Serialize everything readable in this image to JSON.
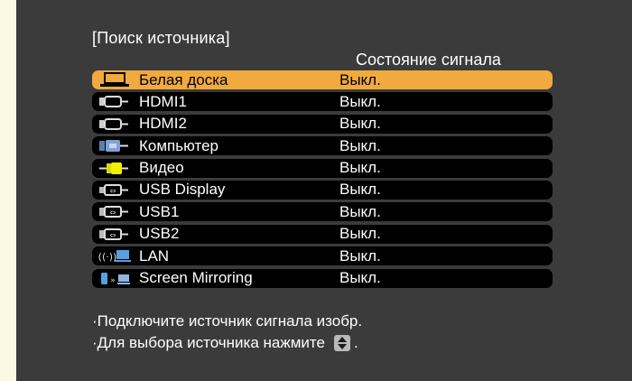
{
  "title": "[Поиск источника]",
  "status_header": "Состояние сигнала",
  "sources": [
    {
      "label": "Белая доска",
      "status": "Выкл.",
      "icon": "whiteboard-icon",
      "selected": true
    },
    {
      "label": "HDMI1",
      "status": "Выкл.",
      "icon": "hdmi-icon",
      "selected": false
    },
    {
      "label": "HDMI2",
      "status": "Выкл.",
      "icon": "hdmi-icon",
      "selected": false
    },
    {
      "label": "Компьютер",
      "status": "Выкл.",
      "icon": "computer-icon",
      "selected": false
    },
    {
      "label": "Видео",
      "status": "Выкл.",
      "icon": "video-icon",
      "selected": false
    },
    {
      "label": "USB Display",
      "status": "Выкл.",
      "icon": "usb-display-icon",
      "selected": false
    },
    {
      "label": "USB1",
      "status": "Выкл.",
      "icon": "usb-icon",
      "selected": false
    },
    {
      "label": "USB2",
      "status": "Выкл.",
      "icon": "usb-icon",
      "selected": false
    },
    {
      "label": "LAN",
      "status": "Выкл.",
      "icon": "lan-icon",
      "selected": false
    },
    {
      "label": "Screen Mirroring",
      "status": "Выкл.",
      "icon": "screen-mirroring-icon",
      "selected": false
    }
  ],
  "footer": {
    "line1": "·Подключите источник сигнала изобр.",
    "line2_prefix": "·Для выбора источника нажмите",
    "line2_suffix": ".",
    "button_icon": "up-down-arrows-icon"
  },
  "colors": {
    "background": "#3b3b3b",
    "row": "#000000",
    "selected_row": "#f0aa3e",
    "page": "#fdf8e2"
  }
}
